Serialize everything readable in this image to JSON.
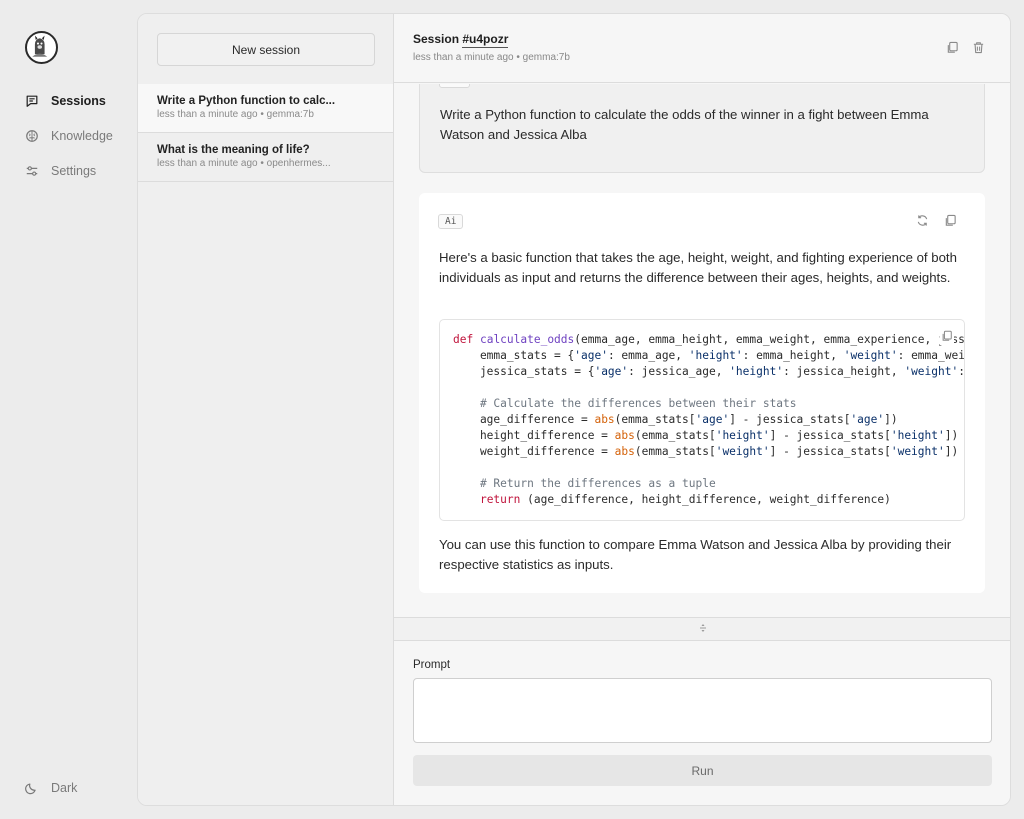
{
  "nav": {
    "logo_icon": "llama-avatar-icon",
    "items": [
      {
        "label": "Sessions",
        "icon": "chat-icon"
      },
      {
        "label": "Knowledge",
        "icon": "brain-icon"
      },
      {
        "label": "Settings",
        "icon": "sliders-icon"
      }
    ],
    "theme_toggle": {
      "label": "Dark",
      "icon": "moon-icon"
    }
  },
  "sessions": {
    "new_label": "New session",
    "items": [
      {
        "title": "Write a Python function to calc...",
        "meta": "less than a minute ago • gemma:7b"
      },
      {
        "title": "What is the meaning of life?",
        "meta": "less than a minute ago • openhermes..."
      }
    ]
  },
  "chat": {
    "header": {
      "prefix": "Session ",
      "session_id": "#u4pozr",
      "meta": "less than a minute ago • gemma:7b"
    },
    "messages": [
      {
        "role": "You",
        "text": "Write a Python function to calculate the odds of the winner in a fight between Emma Watson and Jessica Alba"
      },
      {
        "role": "Ai",
        "intro": "Here's a basic function that takes the age, height, weight, and fighting experience of both individuals as input and returns the difference between their ages, heights, and weights.",
        "code_lines": [
          "def calculate_odds(emma_age, emma_height, emma_weight, emma_experience, jessica_age, jessica_height, jessica_weight, jessica_experience):",
          "    emma_stats = {'age': emma_age, 'height': emma_height, 'weight': emma_weight}",
          "    jessica_stats = {'age': jessica_age, 'height': jessica_height, 'weight': jessica_weight}",
          "",
          "    # Calculate the differences between their stats",
          "    age_difference = abs(emma_stats['age'] - jessica_stats['age'])",
          "    height_difference = abs(emma_stats['height'] - jessica_stats['height'])",
          "    weight_difference = abs(emma_stats['weight'] - jessica_stats['weight'])",
          "",
          "    # Return the differences as a tuple",
          "    return (age_difference, height_difference, weight_difference)"
        ],
        "outro": "You can use this function to compare Emma Watson and Jessica Alba by providing their respective statistics as inputs."
      }
    ],
    "prompt": {
      "label": "Prompt",
      "value": "",
      "run_label": "Run"
    }
  }
}
